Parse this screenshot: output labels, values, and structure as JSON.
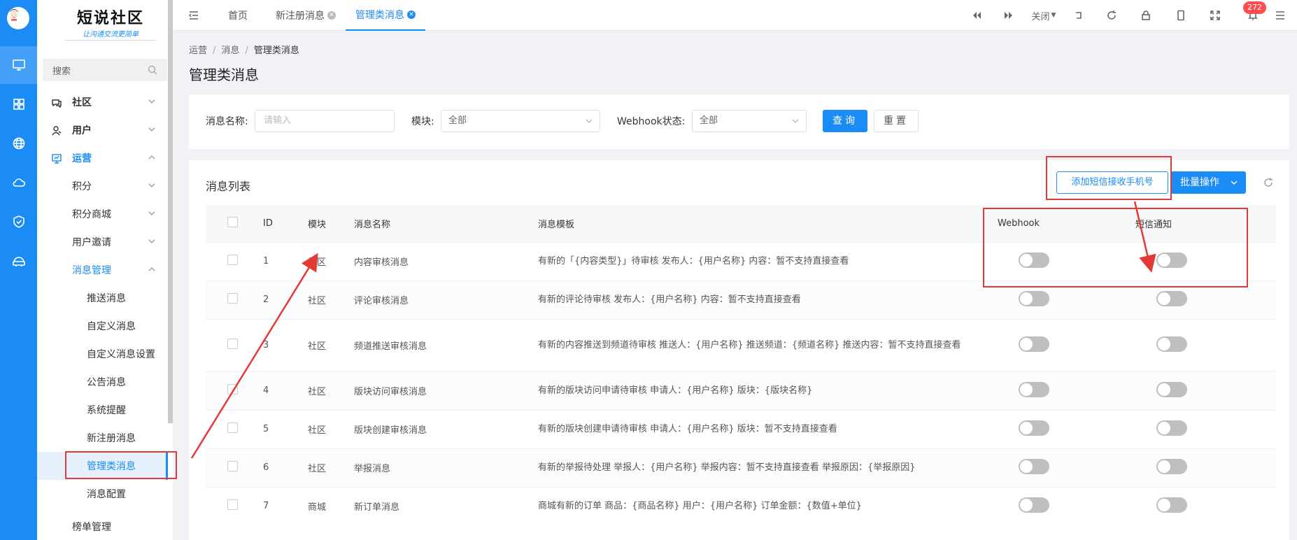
{
  "rail": {
    "icons": [
      "monitor-icon",
      "grid-icon",
      "globe-icon",
      "cloud-icon",
      "shield-icon",
      "router-icon"
    ]
  },
  "logo": {
    "title": "短说社区",
    "subtitle": "让沟通交流更简单"
  },
  "search": {
    "placeholder": "搜索"
  },
  "menu": {
    "community": "社区",
    "users": "用户",
    "operations": "运营",
    "points": "积分",
    "points_mall": "积分商城",
    "user_invite": "用户邀请",
    "message_mgmt": "消息管理",
    "push_msg": "推送消息",
    "custom_msg": "自定义消息",
    "custom_msg_settings": "自定义消息设置",
    "announcement": "公告消息",
    "system_reminder": "系统提醒",
    "new_register_msg": "新注册消息",
    "admin_msg": "管理类消息",
    "msg_config": "消息配置",
    "rank_mgmt": "榜单管理"
  },
  "tabs": {
    "home": "首页",
    "new_register": "新注册消息",
    "admin_msg": "管理类消息"
  },
  "toolbar": {
    "close_label": "关闭",
    "notification_count": "272"
  },
  "breadcrumb": {
    "ops": "运营",
    "msg": "消息",
    "current": "管理类消息"
  },
  "page_title": "管理类消息",
  "filter": {
    "name_label": "消息名称:",
    "name_placeholder": "请输入",
    "module_label": "模块:",
    "module_value": "全部",
    "webhook_label": "Webhook状态:",
    "webhook_value": "全部",
    "query_button": "查询",
    "reset_button": "重置"
  },
  "list": {
    "title": "消息列表",
    "add_phone_button": "添加短信接收手机号",
    "batch_button": "批量操作",
    "columns": {
      "id": "ID",
      "module": "模块",
      "name": "消息名称",
      "template": "消息模板",
      "webhook": "Webhook",
      "sms": "短信通知"
    },
    "rows": [
      {
        "id": "1",
        "module": "社区",
        "name": "内容审核消息",
        "template": "有新的「{内容类型}」待审核 发布人：{用户名称} 内容：暂不支持直接查看",
        "webhook": false,
        "sms": false
      },
      {
        "id": "2",
        "module": "社区",
        "name": "评论审核消息",
        "template": "有新的评论待审核 发布人：{用户名称} 内容：暂不支持直接查看",
        "webhook": false,
        "sms": false
      },
      {
        "id": "3",
        "module": "社区",
        "name": "频道推送审核消息",
        "template": "有新的内容推送到频道待审核 推送人：{用户名称} 推送频道：{频道名称} 推送内容：暂不支持直接查看",
        "webhook": false,
        "sms": false
      },
      {
        "id": "4",
        "module": "社区",
        "name": "版块访问审核消息",
        "template": "有新的版块访问申请待审核 申请人：{用户名称} 版块：{版块名称}",
        "webhook": false,
        "sms": false
      },
      {
        "id": "5",
        "module": "社区",
        "name": "版块创建审核消息",
        "template": "有新的版块创建申请待审核 申请人：{用户名称} 版块：暂不支持直接查看",
        "webhook": false,
        "sms": false
      },
      {
        "id": "6",
        "module": "社区",
        "name": "举报消息",
        "template": "有新的举报待处理 举报人：{用户名称} 举报内容：暂不支持直接查看 举报原因：{举报原因}",
        "webhook": false,
        "sms": false
      },
      {
        "id": "7",
        "module": "商城",
        "name": "新订单消息",
        "template": "商城有新的订单 商品：{商品名称} 用户：{用户名称} 订单金额：{数值+单位}",
        "webhook": false,
        "sms": false
      }
    ]
  },
  "colors": {
    "primary": "#1b8bf5",
    "annotation": "#e53935"
  }
}
